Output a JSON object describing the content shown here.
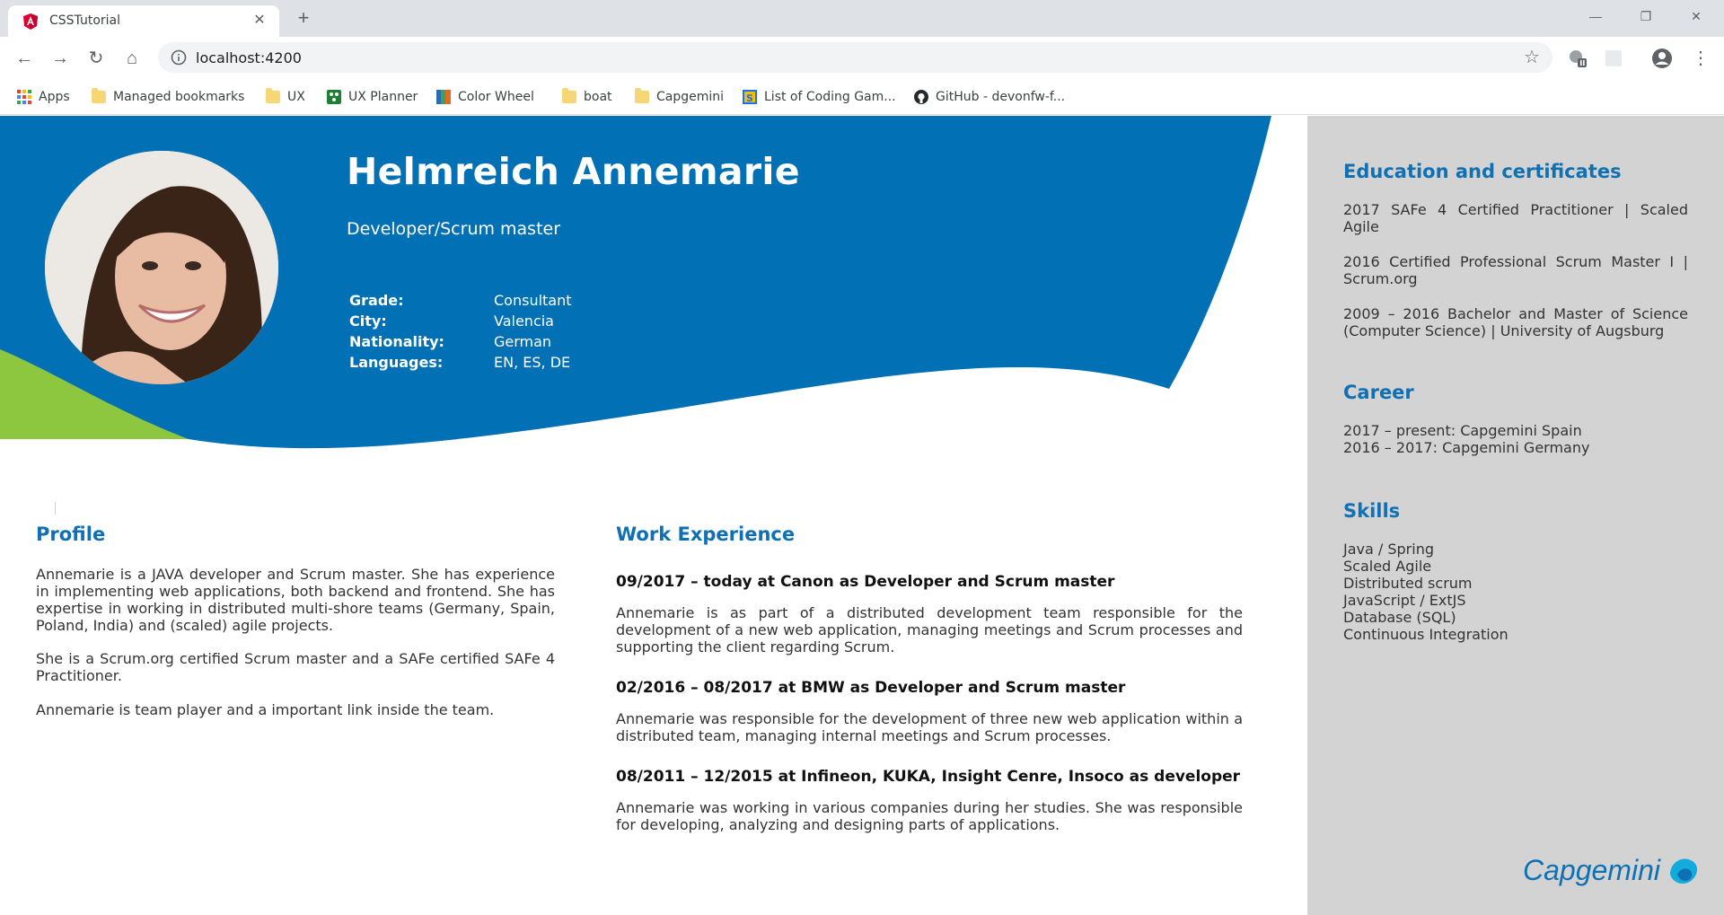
{
  "browser": {
    "tab_title": "CSSTutorial",
    "url": "localhost:4200",
    "bookmarks": [
      "Apps",
      "Managed bookmarks",
      "UX",
      "UX Planner",
      "Color Wheel",
      "boat",
      "Capgemini",
      "List of Coding Gam...",
      "GitHub - devonfw-f..."
    ]
  },
  "header": {
    "name": "Helmreich Annemarie",
    "role": "Developer/Scrum master",
    "facts": [
      {
        "label": "Grade:",
        "value": "Consultant"
      },
      {
        "label": "City:",
        "value": "Valencia"
      },
      {
        "label": "Nationality:",
        "value": "German"
      },
      {
        "label": "Languages:",
        "value": "EN, ES, DE"
      }
    ],
    "colors": {
      "blue": "#0170b5",
      "green": "#8dc63f"
    }
  },
  "profile": {
    "title": "Profile",
    "paragraphs": [
      "Annemarie is a JAVA developer and Scrum master. She has experience in implementing web applications, both backend and frontend. She has expertise in working in distributed multi-shore teams (Germany, Spain, Poland, India) and (scaled) agile projects.",
      "She is a Scrum.org certified Scrum master and a SAFe certified SAFe 4 Practitioner.",
      "Annemarie is team player and a important link inside the team."
    ]
  },
  "work": {
    "title": "Work Experience",
    "jobs": [
      {
        "heading": "09/2017 – today at Canon as Developer and Scrum master",
        "text": "Annemarie is as part of a distributed development team responsible for the development of a new web application, managing meetings and Scrum processes and supporting the client regarding Scrum."
      },
      {
        "heading": "02/2016 – 08/2017 at BMW as Developer and Scrum master",
        "text": "Annemarie was responsible for the development of three new web application within a distributed team, managing internal meetings and Scrum processes."
      },
      {
        "heading": "08/2011 – 12/2015 at Infineon, KUKA, Insight Cenre, Insoco as developer",
        "text": "Annemarie was working in various companies during her studies. She was responsible for developing, analyzing and designing parts of applications."
      }
    ]
  },
  "sidebar": {
    "education_title": "Education and certificates",
    "education": [
      "2017 SAFe 4 Certified Practitioner | Scaled Agile",
      "2016 Certified Professional Scrum Master I | Scrum.org",
      "2009 – 2016 Bachelor and Master of Science (Computer Science) | University of Augsburg"
    ],
    "career_title": "Career",
    "career": [
      "2017 – present: Capgemini Spain",
      "2016 – 2017: Capgemini Germany"
    ],
    "skills_title": "Skills",
    "skills": [
      "Java / Spring",
      "Scaled Agile",
      "Distributed scrum",
      "JavaScript / ExtJS",
      "Database (SQL)",
      "Continuous Integration"
    ],
    "logo_text": "Capgemini"
  }
}
